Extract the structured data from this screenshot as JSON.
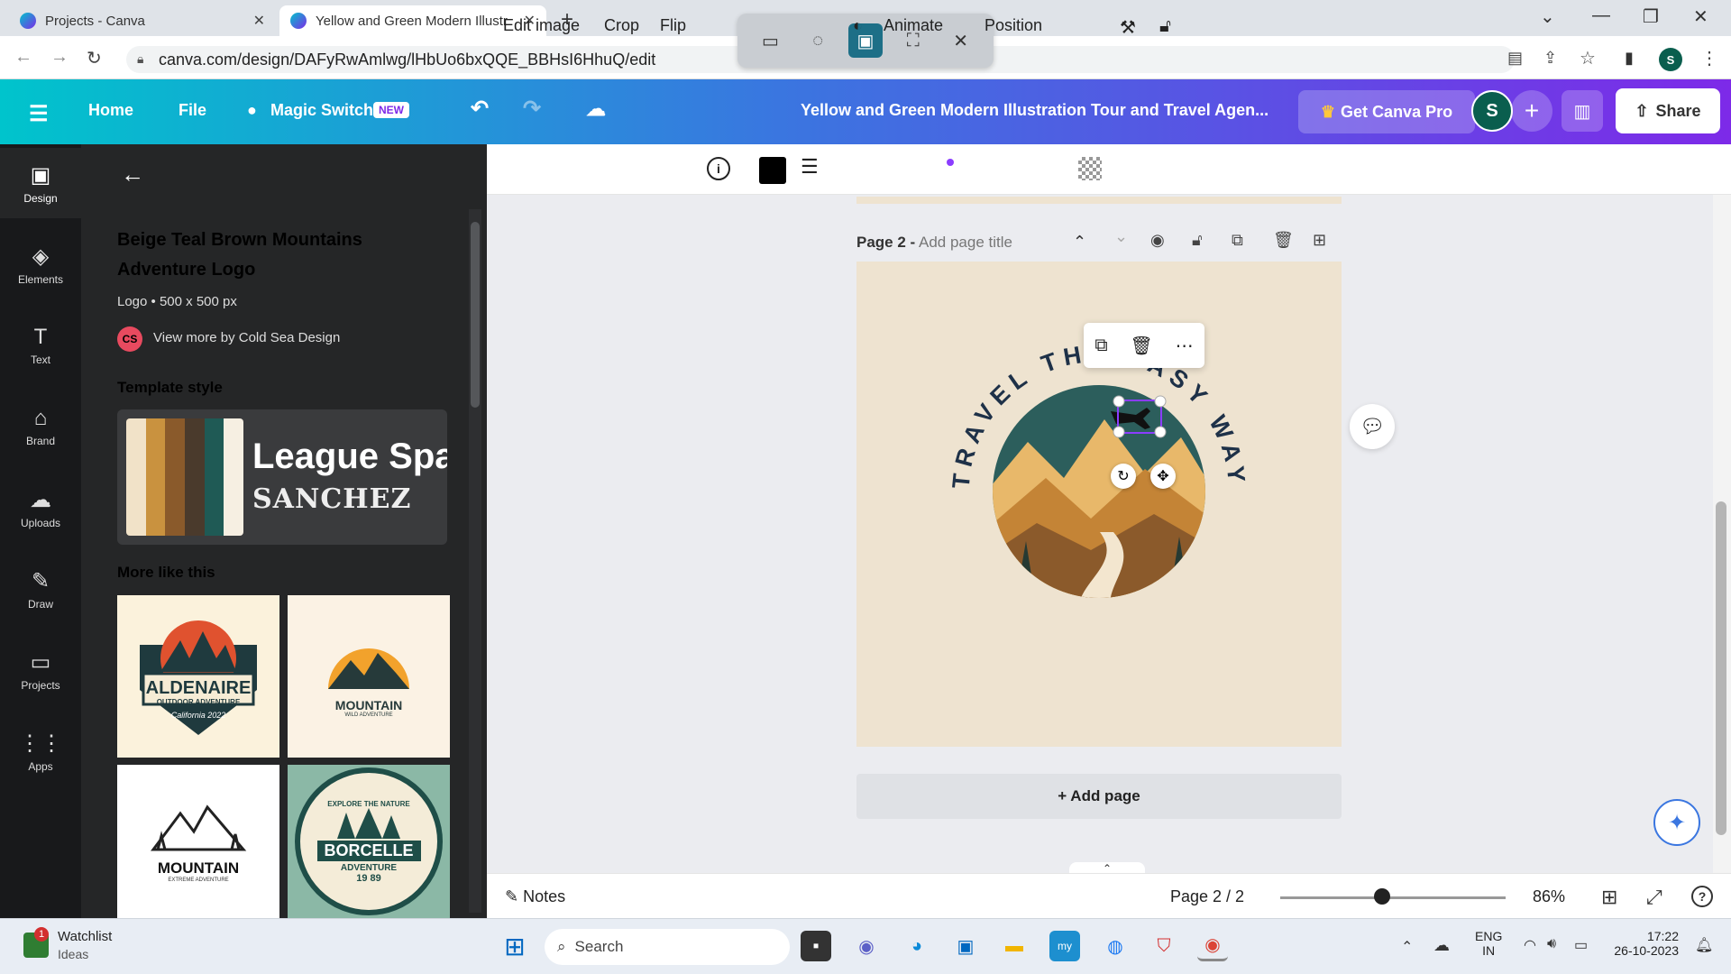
{
  "browser": {
    "tabs": [
      {
        "label": "Projects - Canva"
      },
      {
        "label": "Yellow and Green Modern Illustr"
      }
    ],
    "url": "canva.com/design/DAFyRwAmlwg/lHbUo6bxQQE_BBHsI6HhuQ/edit"
  },
  "header": {
    "home": "Home",
    "file": "File",
    "magic_switch": "Magic Switch",
    "new_badge": "NEW",
    "doc_title": "Yellow and Green Modern Illustration Tour and Travel Agen...",
    "get_pro": "Get Canva Pro",
    "avatar": "S",
    "share": "Share"
  },
  "rail": [
    {
      "label": "Design",
      "icon": "design-icon",
      "glyph": "▣"
    },
    {
      "label": "Elements",
      "icon": "elements-icon",
      "glyph": "◈"
    },
    {
      "label": "Text",
      "icon": "text-icon",
      "glyph": "T"
    },
    {
      "label": "Brand",
      "icon": "brand-icon",
      "glyph": "⌂"
    },
    {
      "label": "Uploads",
      "icon": "uploads-icon",
      "glyph": "☁"
    },
    {
      "label": "Draw",
      "icon": "draw-icon",
      "glyph": "✎"
    },
    {
      "label": "Projects",
      "icon": "projects-icon",
      "glyph": "▭"
    },
    {
      "label": "Apps",
      "icon": "apps-icon",
      "glyph": "⋮⋮"
    }
  ],
  "panel": {
    "template_name": "Beige Teal Brown Mountains Adventure Logo",
    "template_meta": "Logo • 500 x 500 px",
    "creator_initials": "CS",
    "view_more": "View more by Cold Sea Design",
    "template_style": "Template style",
    "style_font1": "League Spa",
    "style_font2": "SANCHEZ",
    "more_like_this": "More like this",
    "thumbs": [
      {
        "title": "ALDENAIRE",
        "sub": "OUTDOOR ADVENTURE",
        "extra": "California 2022"
      },
      {
        "title": "MOUNTAIN",
        "sub": "WILD ADVENTURE",
        "extra": ""
      },
      {
        "title": "MOUNTAIN",
        "sub": "EXTREME ADVENTURE",
        "extra": ""
      },
      {
        "title": "BORCELLE",
        "sub": "ADVENTURE",
        "extra": "EXPLORE THE NATURE",
        "year": "19 89"
      }
    ]
  },
  "toolbar": {
    "edit_image": "Edit image",
    "crop": "Crop",
    "flip": "Flip",
    "animate": "Animate",
    "position": "Position"
  },
  "canvas": {
    "page_label": "Page 2 -",
    "page_title_placeholder": "Add page title",
    "logo_text": "TRAVEL THE EASY WAY",
    "add_page": "+ Add page"
  },
  "footer": {
    "notes": "Notes",
    "page_count": "Page 2 / 2",
    "zoom": "86%",
    "zoom_level": 0.45
  },
  "taskbar": {
    "watchlist": "Watchlist",
    "ideas": "Ideas",
    "badge": "1",
    "search": "Search",
    "lang1": "ENG",
    "lang2": "IN",
    "time": "17:22",
    "date": "26-10-2023"
  }
}
